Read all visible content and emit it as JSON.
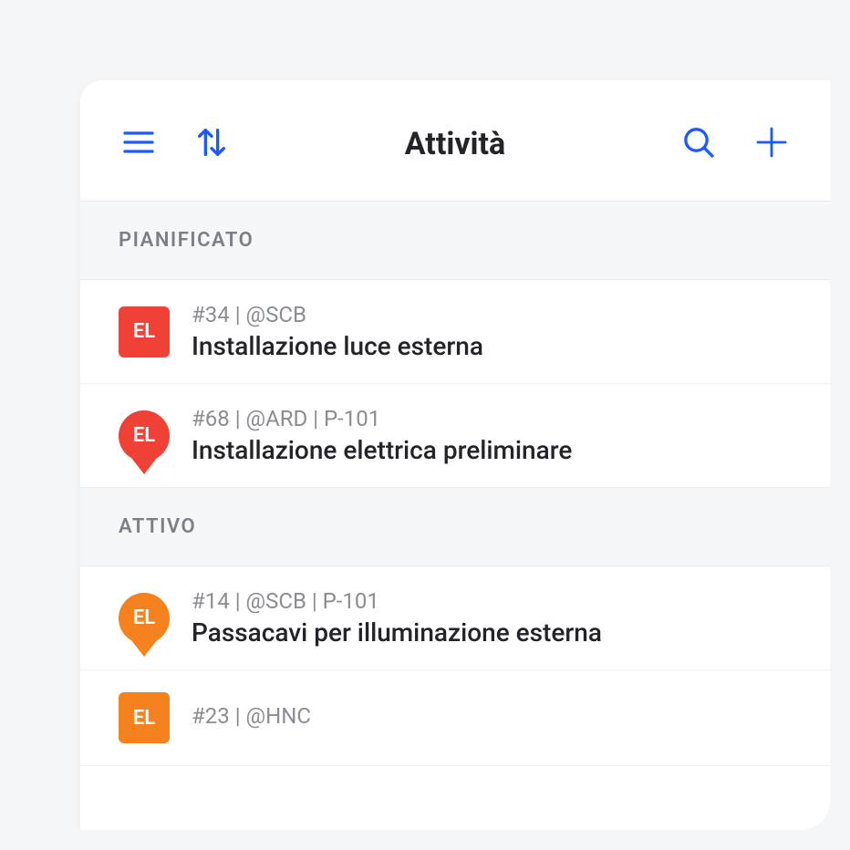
{
  "header": {
    "title": "Attività"
  },
  "sections": {
    "0": {
      "label": "PIANIFICATO",
      "items": {
        "0": {
          "badge_text": "EL",
          "badge_color": "red",
          "badge_shape": "square",
          "meta": "#34 | @SCB",
          "title": "Installazione luce esterna"
        },
        "1": {
          "badge_text": "EL",
          "badge_color": "red",
          "badge_shape": "pin",
          "meta": "#68 | @ARD | P-101",
          "title": "Installazione elettrica preliminare"
        }
      }
    },
    "1": {
      "label": "ATTIVO",
      "items": {
        "0": {
          "badge_text": "EL",
          "badge_color": "orange",
          "badge_shape": "pin",
          "meta": "#14 | @SCB | P-101",
          "title": "Passacavi per illuminazione esterna"
        },
        "1": {
          "badge_text": "EL",
          "badge_color": "orange",
          "badge_shape": "square",
          "meta": "#23 | @HNC",
          "title": ""
        }
      }
    }
  }
}
